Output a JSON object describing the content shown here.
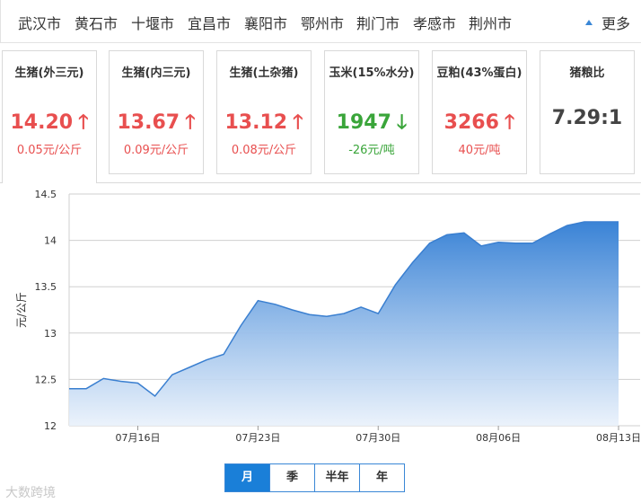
{
  "cities": [
    "武汉市",
    "黄石市",
    "十堰市",
    "宜昌市",
    "襄阳市",
    "鄂州市",
    "荆门市",
    "孝感市",
    "荆州市"
  ],
  "more_label": "更多",
  "cards": [
    {
      "title": "生猪(外三元)",
      "price": "14.20",
      "trend": "up",
      "arrow": "🡑",
      "change": "0.05元/公斤"
    },
    {
      "title": "生猪(内三元)",
      "price": "13.67",
      "trend": "up",
      "arrow": "🡑",
      "change": "0.09元/公斤"
    },
    {
      "title": "生猪(土杂猪)",
      "price": "13.12",
      "trend": "up",
      "arrow": "🡑",
      "change": "0.08元/公斤"
    },
    {
      "title": "玉米(15%水分)",
      "price": "1947",
      "trend": "down",
      "arrow": "🡓",
      "change": "-26元/吨"
    },
    {
      "title": "豆粕(43%蛋白)",
      "price": "3266",
      "trend": "up",
      "arrow": "🡑",
      "change": "40元/吨"
    },
    {
      "title": "猪粮比",
      "price": "7.29:1",
      "trend": "flat",
      "arrow": "",
      "change": ""
    }
  ],
  "colors": {
    "up": "#e84f4f",
    "down": "#3aa53a",
    "accent": "#1a7fd8",
    "area_top": "#3a83d6",
    "area_bottom": "#e9f1fb"
  },
  "tabs": [
    "月",
    "季",
    "半年",
    "年"
  ],
  "active_tab": "月",
  "watermark": "大数跨境",
  "chart_data": {
    "type": "area",
    "ylabel": "元/公斤",
    "ylim": [
      12,
      14.5
    ],
    "yticks": [
      "12",
      "12.5",
      "13",
      "13.5",
      "14",
      "14.5"
    ],
    "xlim": [
      "07-12",
      "08-13"
    ],
    "xticks": [
      {
        "date": "07-16",
        "label": "07月16日"
      },
      {
        "date": "07-23",
        "label": "07月23日"
      },
      {
        "date": "07-30",
        "label": "07月30日"
      },
      {
        "date": "08-06",
        "label": "08月06日"
      },
      {
        "date": "08-13",
        "label": "08月13日"
      }
    ],
    "grid": true,
    "series": [
      {
        "x": [
          "07-12",
          "07-13",
          "07-14",
          "07-15",
          "07-16",
          "07-17",
          "07-18",
          "07-19",
          "07-20",
          "07-21",
          "07-22",
          "07-23",
          "07-24",
          "07-25",
          "07-26",
          "07-27",
          "07-28",
          "07-29",
          "07-30",
          "07-31",
          "08-01",
          "08-02",
          "08-03",
          "08-04",
          "08-05",
          "08-06",
          "08-07",
          "08-08",
          "08-09",
          "08-10",
          "08-11",
          "08-12",
          "08-13"
        ],
        "values": [
          12.4,
          12.4,
          12.51,
          12.48,
          12.46,
          12.32,
          12.55,
          12.63,
          12.71,
          12.77,
          13.08,
          13.35,
          13.31,
          13.25,
          13.2,
          13.18,
          13.21,
          13.28,
          13.21,
          13.52,
          13.76,
          13.97,
          14.06,
          14.08,
          13.94,
          13.98,
          13.97,
          13.97,
          14.07,
          14.16,
          14.2,
          14.2,
          14.2
        ]
      }
    ]
  }
}
